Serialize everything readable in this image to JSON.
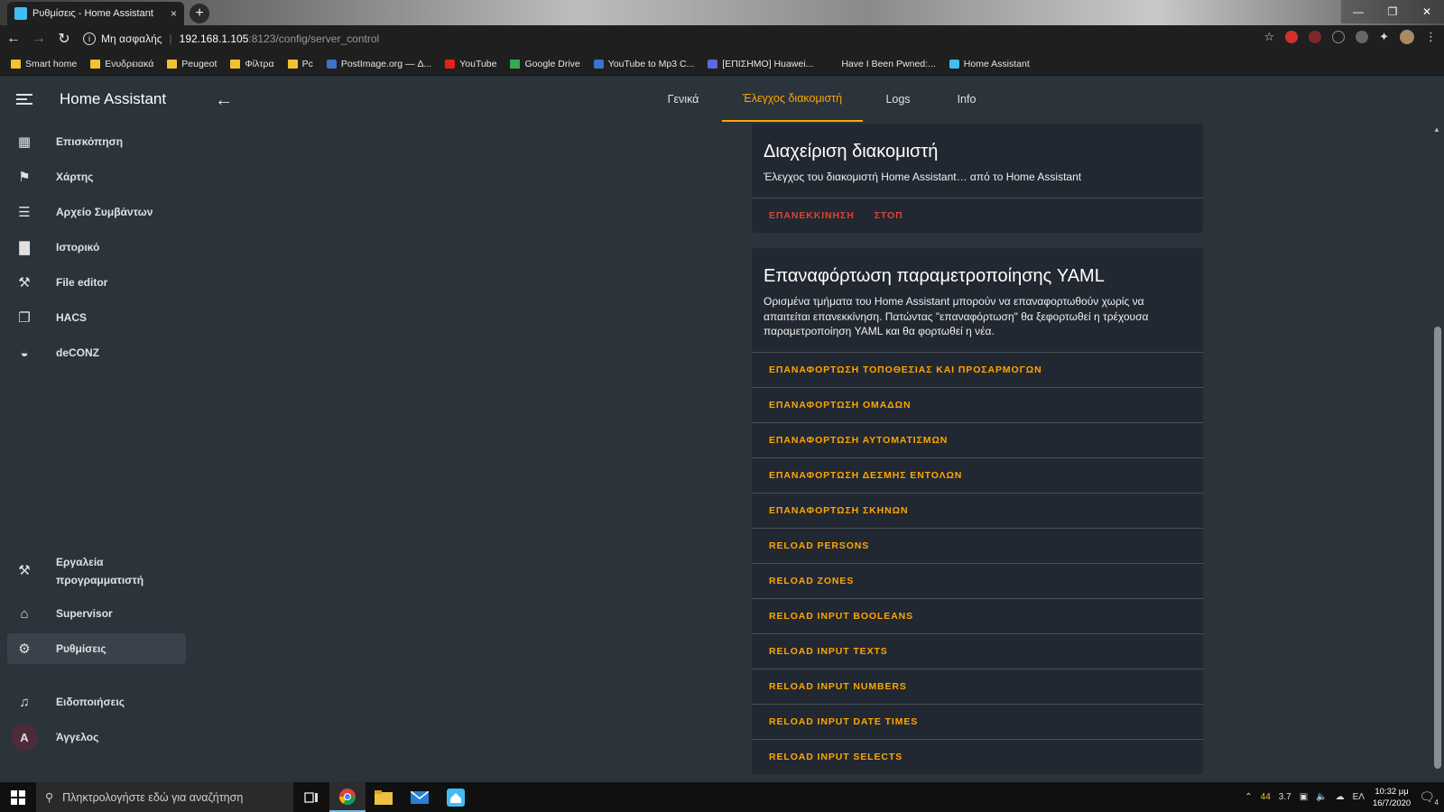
{
  "browser": {
    "tab_title": "Ρυθμίσεις - Home Assistant",
    "tab_close": "×",
    "new_tab": "+",
    "security_label": "Μη ασφαλής",
    "url_host": "192.168.1.105",
    "url_path": ":8123/config/server_control",
    "bookmarks": [
      {
        "label": "Smart home",
        "icon": "folder-icon"
      },
      {
        "label": "Ενυδρειακά",
        "icon": "folder-icon"
      },
      {
        "label": "Peugeot",
        "icon": "folder-icon"
      },
      {
        "label": "Φίλτρα",
        "icon": "folder-icon"
      },
      {
        "label": "Pc",
        "icon": "folder-icon"
      },
      {
        "label": "PostImage.org — Δ...",
        "icon": "postimage-icon"
      },
      {
        "label": "YouTube",
        "icon": "youtube-icon"
      },
      {
        "label": "Google Drive",
        "icon": "google-drive-icon"
      },
      {
        "label": "YouTube to Mp3 C...",
        "icon": "globe-icon"
      },
      {
        "label": "[ΕΠΙΣΗΜΟ] Huawei...",
        "icon": "huawei-icon"
      },
      {
        "label": "Have I Been Pwned:...",
        "icon": "pwned-icon"
      },
      {
        "label": "Home Assistant",
        "icon": "home-assistant-icon"
      }
    ]
  },
  "app": {
    "title": "Home Assistant",
    "sidebar": {
      "items": [
        {
          "label": "Επισκόπηση",
          "icon": "dashboard-icon"
        },
        {
          "label": "Χάρτης",
          "icon": "map-icon"
        },
        {
          "label": "Αρχείο Συμβάντων",
          "icon": "logbook-icon"
        },
        {
          "label": "Ιστορικό",
          "icon": "history-icon"
        },
        {
          "label": "File editor",
          "icon": "wrench-icon"
        },
        {
          "label": "HACS",
          "icon": "hacs-icon"
        },
        {
          "label": "deCONZ",
          "icon": "deconz-icon"
        }
      ],
      "bottom": [
        {
          "label": "Εργαλεία προγραμματιστή",
          "icon": "hammer-icon"
        },
        {
          "label": "Supervisor",
          "icon": "supervisor-icon"
        },
        {
          "label": "Ρυθμίσεις",
          "icon": "gear-icon",
          "active": true
        },
        {
          "label": "Ειδοποιήσεις",
          "icon": "bell-icon"
        },
        {
          "label": "Άγγελος",
          "icon": "avatar",
          "initial": "Α"
        }
      ]
    },
    "tabs": [
      "Γενικά",
      "Έλεγχος διακομιστή",
      "Logs",
      "Info"
    ],
    "active_tab": 1,
    "server_card": {
      "title": "Διαχείριση διακομιστή",
      "description": "Έλεγχος του διακομιστή Home Assistant… από το Home Assistant",
      "restart": "ΕΠΑΝΕΚΚΙΝΗΣΗ",
      "stop": "ΣΤΟΠ"
    },
    "reload_card": {
      "title": "Επαναφόρτωση παραμετροποίησης YAML",
      "description": "Ορισμένα τμήματα του Home Assistant μπορούν να επαναφορτωθούν χωρίς να απαιτείται επανεκκίνηση. Πατώντας \"επαναφόρτωση\" θα ξεφορτωθεί η τρέχουσα παραμετροποίηση YAML και θα φορτωθεί η νέα.",
      "actions": [
        "ΕΠΑΝΑΦΟΡΤΩΣΗ ΤΟΠΟΘΕΣΙΑΣ ΚΑΙ ΠΡΟΣΑΡΜΟΓΩΝ",
        "ΕΠΑΝΑΦΟΡΤΩΣΗ ΟΜΑΔΩΝ",
        "ΕΠΑΝΑΦΟΡΤΩΣΗ ΑΥΤΟΜΑΤΙΣΜΩΝ",
        "ΕΠΑΝΑΦΟΡΤΩΣΗ ΔΕΣΜΗΣ ΕΝΤΟΛΩΝ",
        "ΕΠΑΝΑΦΟΡΤΩΣΗ ΣΚΗΝΩΝ",
        "RELOAD PERSONS",
        "RELOAD ZONES",
        "RELOAD INPUT BOOLEANS",
        "RELOAD INPUT TEXTS",
        "RELOAD INPUT NUMBERS",
        "RELOAD INPUT DATE TIMES",
        "RELOAD INPUT SELECTS"
      ]
    },
    "colors": {
      "accent": "#ffa600",
      "danger": "#db4437",
      "background": "#2b333b",
      "card": "#222831"
    }
  },
  "taskbar": {
    "search_placeholder": "Πληκτρολογήστε εδώ για αναζήτηση",
    "tray_temp": "44",
    "tray_num": "3.7",
    "language": "ΕΛ",
    "time": "10:32 μμ",
    "date": "16/7/2020",
    "notifications": "4"
  }
}
